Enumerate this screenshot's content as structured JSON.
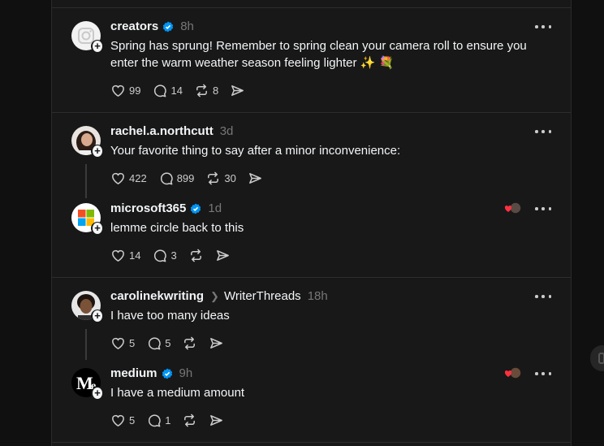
{
  "posts": [
    {
      "username": "creators",
      "time": "8h",
      "verified": true,
      "text": "Spring has sprung! Remember to spring clean your camera roll to ensure you enter the warm weather season feeling lighter ✨ 💐",
      "likes": "99",
      "replies": "14",
      "reposts": "8"
    },
    {
      "username": "rachel.a.northcutt",
      "time": "3d",
      "verified": false,
      "text": "Your favorite thing to say after a minor inconvenience:",
      "likes": "422",
      "replies": "899",
      "reposts": "30"
    },
    {
      "username": "microsoft365",
      "time": "1d",
      "verified": true,
      "text": "lemme circle back to this",
      "likes": "14",
      "replies": "3",
      "reposts": ""
    },
    {
      "username": "carolinekwriting",
      "community": "WriterThreads",
      "time": "18h",
      "verified": false,
      "text": "I have too many ideas",
      "likes": "5",
      "replies": "5",
      "reposts": ""
    },
    {
      "username": "medium",
      "time": "9h",
      "verified": true,
      "text": "I have a medium amount",
      "likes": "5",
      "replies": "1",
      "reposts": ""
    }
  ],
  "icons": {
    "like": "heart-icon",
    "reply": "comment-icon",
    "repost": "repost-icon",
    "share": "share-icon",
    "more": "more-icon",
    "verified": "verified-badge-icon"
  },
  "colors": {
    "background": "#101010",
    "card": "#181818",
    "verified": "#0095f6",
    "muted": "#777777"
  }
}
